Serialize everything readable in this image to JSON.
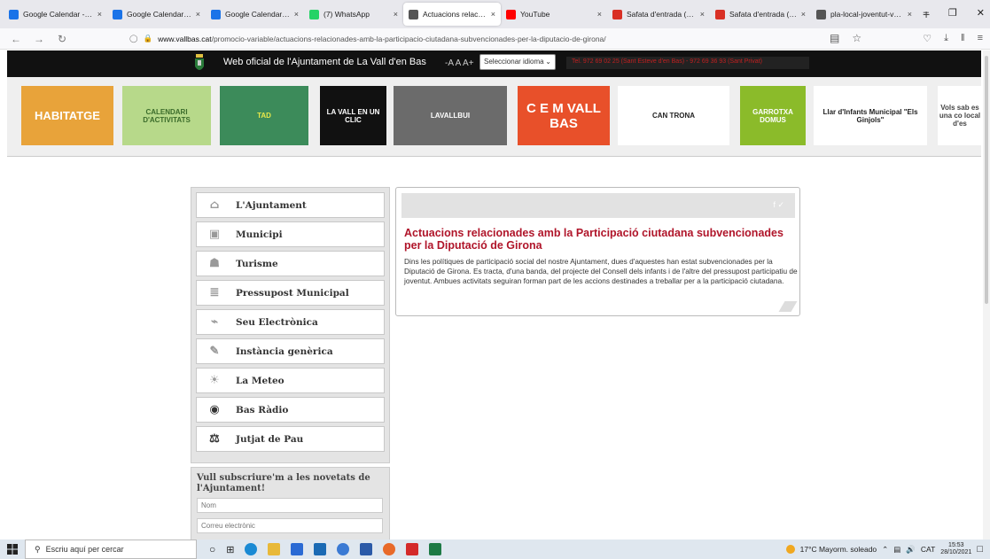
{
  "browser": {
    "tabs": [
      {
        "title": "Google Calendar - Setma",
        "color": "#1a73e8",
        "active": false
      },
      {
        "title": "Google Calendar - Setma",
        "color": "#1a73e8",
        "active": false
      },
      {
        "title": "Google Calendar - Setma",
        "color": "#1a73e8",
        "active": false
      },
      {
        "title": "(7) WhatsApp",
        "color": "#25d366",
        "active": false
      },
      {
        "title": "Actuacions relacionades",
        "color": "#555555",
        "active": true
      },
      {
        "title": "YouTube",
        "color": "#ff0000",
        "active": false
      },
      {
        "title": "Safata d'entrada (396) - é",
        "color": "#d93025",
        "active": false
      },
      {
        "title": "Safata d'entrada (346) - é",
        "color": "#d93025",
        "active": false
      },
      {
        "title": "pla-local-joventut-vall-b",
        "color": "#555555",
        "active": false
      }
    ],
    "new_tab": "+",
    "window_controls": [
      "–",
      "❐",
      "✕"
    ],
    "url_domain": "www.vallbas.cat",
    "url_path": "/promocio-variable/actuacions-relacionades-amb-la-participacio-ciutadana-subvencionades-per-la-diputacio-de-girona/"
  },
  "site": {
    "title": "Web oficial de l'Ajuntament de La Vall d'en Bas",
    "font_sizes": "-A A A+",
    "language_select": "Seleccionar idioma",
    "phone": "Tel. 972 69 02 25 (Sant Esteve d'en Bas) - 972 69 36 93 (Sant Privat)"
  },
  "banner": [
    {
      "label": "HABITATGE",
      "bg": "#e8a33a",
      "fg": "#ffffff"
    },
    {
      "label": "CALENDARI D'ACTIVITATS",
      "bg": "#b7d98a",
      "fg": "#3a6b2a"
    },
    {
      "label": "TAD",
      "bg": "#3c8b5a",
      "fg": "#e8e84a"
    },
    {
      "label": "LA VALL EN UN CLIC",
      "bg": "#111111",
      "fg": "#ffffff"
    },
    {
      "label": "LAVALLBUI",
      "bg": "#6b6b6b",
      "fg": "#ffffff"
    },
    {
      "label": "C E M VALL BAS",
      "bg": "#e8502a",
      "fg": "#ffffff"
    },
    {
      "label": "CAN TRONA",
      "bg": "#ffffff",
      "fg": "#222222"
    },
    {
      "label": "GARROTXA DOMUS",
      "bg": "#8bbb2a",
      "fg": "#ffffff"
    },
    {
      "label": "Llar d'Infants Municipal \"Els Ginjols\"",
      "bg": "#ffffff",
      "fg": "#222222"
    },
    {
      "label": "Vols sab es una co local d'es",
      "bg": "#ffffff",
      "fg": "#444444"
    }
  ],
  "menu": [
    {
      "label": "L'Ajuntament",
      "icon": "building-icon"
    },
    {
      "label": "Municipi",
      "icon": "map-icon"
    },
    {
      "label": "Turisme",
      "icon": "tourism-icon"
    },
    {
      "label": "Pressupost Municipal",
      "icon": "budget-icon"
    },
    {
      "label": "Seu Electrònica",
      "icon": "e-office-icon"
    },
    {
      "label": "Instància genèrica",
      "icon": "form-icon"
    },
    {
      "label": "La Meteo",
      "icon": "weather-icon"
    },
    {
      "label": "Bas Ràdio",
      "icon": "radio-icon"
    },
    {
      "label": "Jutjat de Pau",
      "icon": "scales-icon"
    }
  ],
  "subscribe": {
    "heading": "Vull subscriure'm a les novetats de l'Ajuntament!",
    "name_placeholder": "Nom",
    "email_placeholder": "Correu electrònic"
  },
  "article": {
    "title": "Actuacions relacionades amb la Participació ciutadana subvencionades per la Diputació de Girona",
    "body": "Dins les polítiques de participació social del nostre Ajuntament, dues d'aquestes han estat subvencionades per la Diputació de Girona. Es tracta, d'una banda, del projecte del Consell dels infants i de l'altre del pressupost participatiu de joventut.  Ambues activitats seguiran forman part de les accions destinades a treballar per a la participació ciutadana.",
    "social": "f  ✓"
  },
  "taskbar": {
    "search_placeholder": "Escriu aquí per cercar",
    "weather": "17°C  Mayorm. soleado",
    "lang": "CAT",
    "time": "15:53",
    "date": "28/10/2021"
  },
  "colors": {
    "accent": "#b0152a",
    "header": "#111111"
  }
}
